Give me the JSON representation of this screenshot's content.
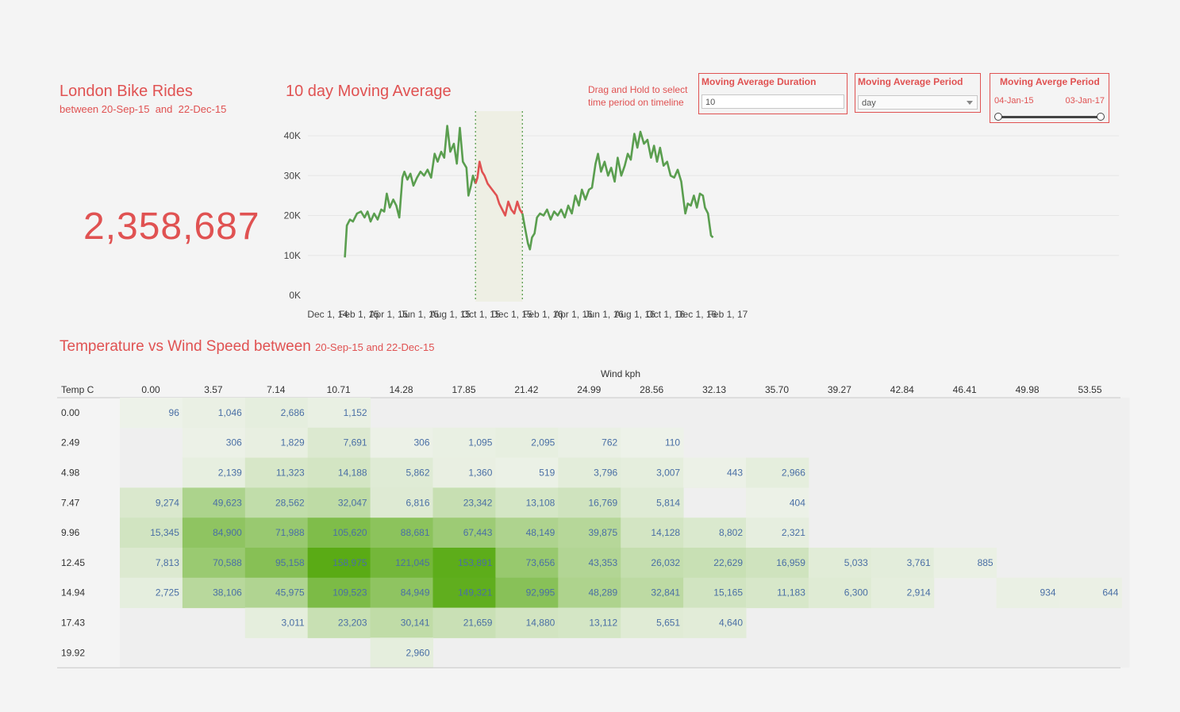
{
  "header": {
    "title": "London Bike Rides",
    "subtitle": "between 20-Sep-15  and  22-Dec-15",
    "total": "2,358,687"
  },
  "chart_header": {
    "title": "10 day Moving Average",
    "drag_hint": "Drag and Hold to select time period on timeline"
  },
  "controls": {
    "duration": {
      "label": "Moving Average Duration",
      "value": "10"
    },
    "period": {
      "label": "Moving Average Period",
      "value": "day"
    },
    "range": {
      "label": "Moving Averge Period",
      "start": "04-Jan-15",
      "end": "03-Jan-17"
    }
  },
  "colors": {
    "accent": "#e05252",
    "line": "#5a9e4f",
    "highlight": "#e05252",
    "selection_fill": "#eeefe4",
    "heat_low": "#eef2ea",
    "heat_high": "#5aab15",
    "heat_text": "#4a6fa5"
  },
  "chart_data": [
    {
      "type": "line",
      "title": "10 day Moving Average",
      "x_ticks": [
        "Dec 1, 14",
        "Feb 1, 15",
        "Apr 1, 15",
        "Jun 1, 15",
        "Aug 1, 15",
        "Oct 1, 15",
        "Dec 1, 15",
        "Feb 1, 16",
        "Apr 1, 16",
        "Jun 1, 16",
        "Aug 1, 16",
        "Oct 1, 16",
        "Dec 1, 16",
        "Feb 1, 17"
      ],
      "y_ticks": [
        "0K",
        "10K",
        "20K",
        "30K",
        "40K"
      ],
      "ylim": [
        0,
        43000
      ],
      "selection": {
        "start": "2015-09-20",
        "end": "2015-12-22"
      },
      "series": [
        {
          "points": [
            [
              "2015-01-04",
              9500
            ],
            [
              "2015-01-08",
              17500
            ],
            [
              "2015-01-14",
              19000
            ],
            [
              "2015-01-20",
              18500
            ],
            [
              "2015-01-28",
              20500
            ],
            [
              "2015-02-05",
              21000
            ],
            [
              "2015-02-12",
              19500
            ],
            [
              "2015-02-18",
              21000
            ],
            [
              "2015-02-24",
              18500
            ],
            [
              "2015-03-03",
              20500
            ],
            [
              "2015-03-10",
              19000
            ],
            [
              "2015-03-17",
              21500
            ],
            [
              "2015-03-23",
              21000
            ],
            [
              "2015-03-28",
              25500
            ],
            [
              "2015-04-03",
              22000
            ],
            [
              "2015-04-10",
              24000
            ],
            [
              "2015-04-16",
              22500
            ],
            [
              "2015-04-22",
              19500
            ],
            [
              "2015-04-28",
              29500
            ],
            [
              "2015-05-02",
              31000
            ],
            [
              "2015-05-08",
              29000
            ],
            [
              "2015-05-14",
              30500
            ],
            [
              "2015-05-20",
              27500
            ],
            [
              "2015-05-27",
              29500
            ],
            [
              "2015-06-03",
              31000
            ],
            [
              "2015-06-10",
              30000
            ],
            [
              "2015-06-17",
              31500
            ],
            [
              "2015-06-24",
              29500
            ],
            [
              "2015-07-01",
              35500
            ],
            [
              "2015-07-07",
              33500
            ],
            [
              "2015-07-14",
              36000
            ],
            [
              "2015-07-20",
              34500
            ],
            [
              "2015-07-26",
              42500
            ],
            [
              "2015-08-01",
              36000
            ],
            [
              "2015-08-08",
              38000
            ],
            [
              "2015-08-14",
              33000
            ],
            [
              "2015-08-20",
              42000
            ],
            [
              "2015-08-26",
              33500
            ],
            [
              "2015-09-02",
              32000
            ],
            [
              "2015-09-06",
              25000
            ],
            [
              "2015-09-11",
              27500
            ],
            [
              "2015-09-15",
              30000
            ],
            [
              "2015-09-20",
              28000
            ],
            [
              "2015-09-24",
              29500
            ],
            [
              "2015-09-28",
              33500
            ],
            [
              "2015-10-03",
              31000
            ],
            [
              "2015-10-08",
              30000
            ],
            [
              "2015-10-14",
              28000
            ],
            [
              "2015-10-20",
              27000
            ],
            [
              "2015-10-26",
              26000
            ],
            [
              "2015-11-01",
              25000
            ],
            [
              "2015-11-06",
              23000
            ],
            [
              "2015-11-12",
              21500
            ],
            [
              "2015-11-18",
              20000
            ],
            [
              "2015-11-24",
              23500
            ],
            [
              "2015-11-30",
              21500
            ],
            [
              "2015-12-06",
              20500
            ],
            [
              "2015-12-12",
              23500
            ],
            [
              "2015-12-17",
              21500
            ],
            [
              "2015-12-22",
              20500
            ],
            [
              "2015-12-27",
              17000
            ],
            [
              "2016-01-02",
              13000
            ],
            [
              "2016-01-06",
              11500
            ],
            [
              "2016-01-10",
              14500
            ],
            [
              "2016-01-15",
              15500
            ],
            [
              "2016-01-20",
              19500
            ],
            [
              "2016-01-26",
              20500
            ],
            [
              "2016-02-02",
              20000
            ],
            [
              "2016-02-09",
              21500
            ],
            [
              "2016-02-16",
              19000
            ],
            [
              "2016-02-23",
              21000
            ],
            [
              "2016-03-01",
              20000
            ],
            [
              "2016-03-08",
              21500
            ],
            [
              "2016-03-15",
              19500
            ],
            [
              "2016-03-22",
              22500
            ],
            [
              "2016-03-29",
              20500
            ],
            [
              "2016-04-05",
              25000
            ],
            [
              "2016-04-12",
              22500
            ],
            [
              "2016-04-18",
              26500
            ],
            [
              "2016-04-25",
              24000
            ],
            [
              "2016-05-02",
              26500
            ],
            [
              "2016-05-08",
              27000
            ],
            [
              "2016-05-15",
              33000
            ],
            [
              "2016-05-20",
              35500
            ],
            [
              "2016-05-26",
              31000
            ],
            [
              "2016-06-02",
              33500
            ],
            [
              "2016-06-09",
              30000
            ],
            [
              "2016-06-15",
              32000
            ],
            [
              "2016-06-22",
              28500
            ],
            [
              "2016-06-28",
              34500
            ],
            [
              "2016-07-05",
              30000
            ],
            [
              "2016-07-12",
              32500
            ],
            [
              "2016-07-18",
              35500
            ],
            [
              "2016-07-24",
              34000
            ],
            [
              "2016-07-31",
              40500
            ],
            [
              "2016-08-06",
              37000
            ],
            [
              "2016-08-12",
              41000
            ],
            [
              "2016-08-19",
              38000
            ],
            [
              "2016-08-26",
              39000
            ],
            [
              "2016-09-02",
              34500
            ],
            [
              "2016-09-08",
              37500
            ],
            [
              "2016-09-14",
              33500
            ],
            [
              "2016-09-20",
              37000
            ],
            [
              "2016-09-27",
              32500
            ],
            [
              "2016-10-04",
              33500
            ],
            [
              "2016-10-11",
              30000
            ],
            [
              "2016-10-18",
              29500
            ],
            [
              "2016-10-25",
              31500
            ],
            [
              "2016-11-01",
              28500
            ],
            [
              "2016-11-05",
              24500
            ],
            [
              "2016-11-09",
              20500
            ],
            [
              "2016-11-14",
              23000
            ],
            [
              "2016-11-20",
              22500
            ],
            [
              "2016-11-26",
              25000
            ],
            [
              "2016-12-02",
              22000
            ],
            [
              "2016-12-08",
              25500
            ],
            [
              "2016-12-14",
              25000
            ],
            [
              "2016-12-18",
              22000
            ],
            [
              "2016-12-24",
              20500
            ],
            [
              "2016-12-30",
              15000
            ],
            [
              "2017-01-03",
              14500
            ]
          ]
        }
      ]
    },
    {
      "type": "heatmap",
      "title": "Temperature vs Wind Speed between",
      "subtitle": "20-Sep-15 and 22-Dec-15",
      "xlabel": "Wind kph",
      "ylabel": "Temp C",
      "x": [
        "0.00",
        "3.57",
        "7.14",
        "10.71",
        "14.28",
        "17.85",
        "21.42",
        "24.99",
        "28.56",
        "32.13",
        "35.70",
        "39.27",
        "42.84",
        "46.41",
        "49.98",
        "53.55"
      ],
      "y": [
        "0.00",
        "2.49",
        "4.98",
        "7.47",
        "9.96",
        "12.45",
        "14.94",
        "17.43",
        "19.92"
      ],
      "values": [
        [
          96,
          1046,
          2686,
          1152,
          null,
          null,
          null,
          null,
          null,
          null,
          null,
          null,
          null,
          null,
          null,
          null
        ],
        [
          null,
          306,
          1829,
          7691,
          306,
          1095,
          2095,
          762,
          110,
          null,
          null,
          null,
          null,
          null,
          null,
          null
        ],
        [
          null,
          2139,
          11323,
          14188,
          5862,
          1360,
          519,
          3796,
          3007,
          443,
          2966,
          null,
          null,
          null,
          null,
          null
        ],
        [
          9274,
          49623,
          28562,
          32047,
          6816,
          23342,
          13108,
          16769,
          5814,
          null,
          404,
          null,
          null,
          null,
          null,
          null
        ],
        [
          15345,
          84900,
          71988,
          105620,
          88681,
          67443,
          48149,
          39875,
          14128,
          8802,
          2321,
          null,
          null,
          null,
          null,
          null
        ],
        [
          7813,
          70588,
          95158,
          158975,
          121045,
          153891,
          73656,
          43353,
          26032,
          22629,
          16959,
          5033,
          3761,
          885,
          null,
          null
        ],
        [
          2725,
          38106,
          45975,
          109523,
          84949,
          149321,
          92995,
          48289,
          32841,
          15165,
          11183,
          6300,
          2914,
          null,
          934,
          644
        ],
        [
          null,
          null,
          3011,
          23203,
          30141,
          21659,
          14880,
          13112,
          5651,
          4640,
          null,
          null,
          null,
          null,
          null,
          null
        ],
        [
          null,
          null,
          null,
          null,
          2960,
          null,
          null,
          null,
          null,
          null,
          null,
          null,
          null,
          null,
          null,
          null
        ]
      ],
      "value_labels": [
        [
          "96",
          "1,046",
          "2,686",
          "1,152",
          "",
          "",
          "",
          "",
          "",
          "",
          "",
          "",
          "",
          "",
          "",
          ""
        ],
        [
          "",
          "306",
          "1,829",
          "7,691",
          "306",
          "1,095",
          "2,095",
          "762",
          "110",
          "",
          "",
          "",
          "",
          "",
          "",
          ""
        ],
        [
          "",
          "2,139",
          "11,323",
          "14,188",
          "5,862",
          "1,360",
          "519",
          "3,796",
          "3,007",
          "443",
          "2,966",
          "",
          "",
          "",
          "",
          ""
        ],
        [
          "9,274",
          "49,623",
          "28,562",
          "32,047",
          "6,816",
          "23,342",
          "13,108",
          "16,769",
          "5,814",
          "",
          "404",
          "",
          "",
          "",
          "",
          ""
        ],
        [
          "15,345",
          "84,900",
          "71,988",
          "105,620",
          "88,681",
          "67,443",
          "48,149",
          "39,875",
          "14,128",
          "8,802",
          "2,321",
          "",
          "",
          "",
          "",
          ""
        ],
        [
          "7,813",
          "70,588",
          "95,158",
          "158,975",
          "121,045",
          "153,891",
          "73,656",
          "43,353",
          "26,032",
          "22,629",
          "16,959",
          "5,033",
          "3,761",
          "885",
          "",
          ""
        ],
        [
          "2,725",
          "38,106",
          "45,975",
          "109,523",
          "84,949",
          "149,321",
          "92,995",
          "48,289",
          "32,841",
          "15,165",
          "11,183",
          "6,300",
          "2,914",
          "",
          "934",
          "644"
        ],
        [
          "",
          "",
          "3,011",
          "23,203",
          "30,141",
          "21,659",
          "14,880",
          "13,112",
          "5,651",
          "4,640",
          "",
          "",
          "",
          "",
          "",
          ""
        ],
        [
          "",
          "",
          "",
          "",
          "2,960",
          "",
          "",
          "",
          "",
          "",
          "",
          "",
          "",
          "",
          "",
          ""
        ]
      ]
    }
  ]
}
